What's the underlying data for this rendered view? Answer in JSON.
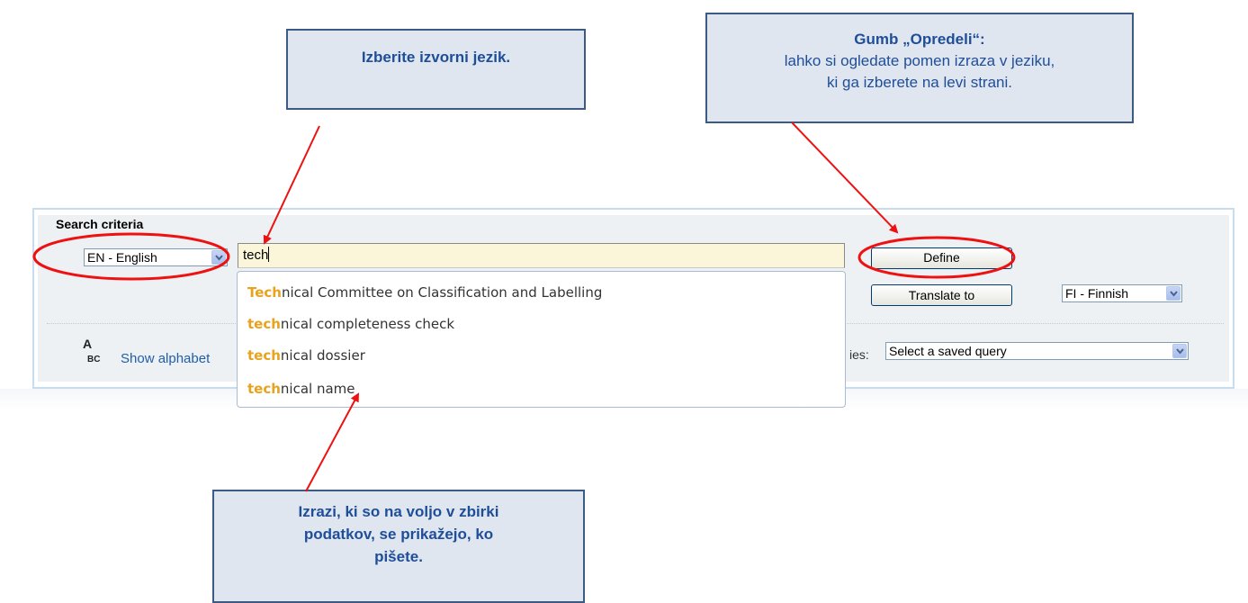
{
  "callouts": {
    "source_language": "Izberite izvorni jezik.",
    "define_title": "Gumb „Opredeli“:",
    "define_line1": "lahko si ogledate pomen izraza v jeziku,",
    "define_line2": "ki ga izberete na levi strani.",
    "suggestions_line1": "Izrazi, ki so na voljo v zbirki",
    "suggestions_line2": "podatkov, se prikažejo, ko",
    "suggestions_line3": "pišete."
  },
  "search": {
    "criteria_label": "Search criteria",
    "source_language": "EN - English",
    "input_value": "tech",
    "define_label": "Define",
    "translate_label": "Translate to",
    "target_language": "FI - Finnish",
    "alphabet_icon": "abc-icon",
    "alphabet_icon_top": "A",
    "alphabet_icon_bottom": "BC",
    "show_alphabet_label": "Show alphabet",
    "queries_label": "ies:",
    "saved_query_placeholder": "Select a saved query"
  },
  "suggestions": [
    {
      "match": "Tech",
      "rest": "nical Committee on Classification and Labelling"
    },
    {
      "match": "tech",
      "rest": "nical completeness check"
    },
    {
      "match": "tech",
      "rest": "nical dossier"
    },
    {
      "match": "tech",
      "rest": "nical name"
    }
  ],
  "colors": {
    "annotation_red": "#ee1111",
    "highlight_orange": "#e8a21b",
    "callout_text": "#1f4e99"
  }
}
